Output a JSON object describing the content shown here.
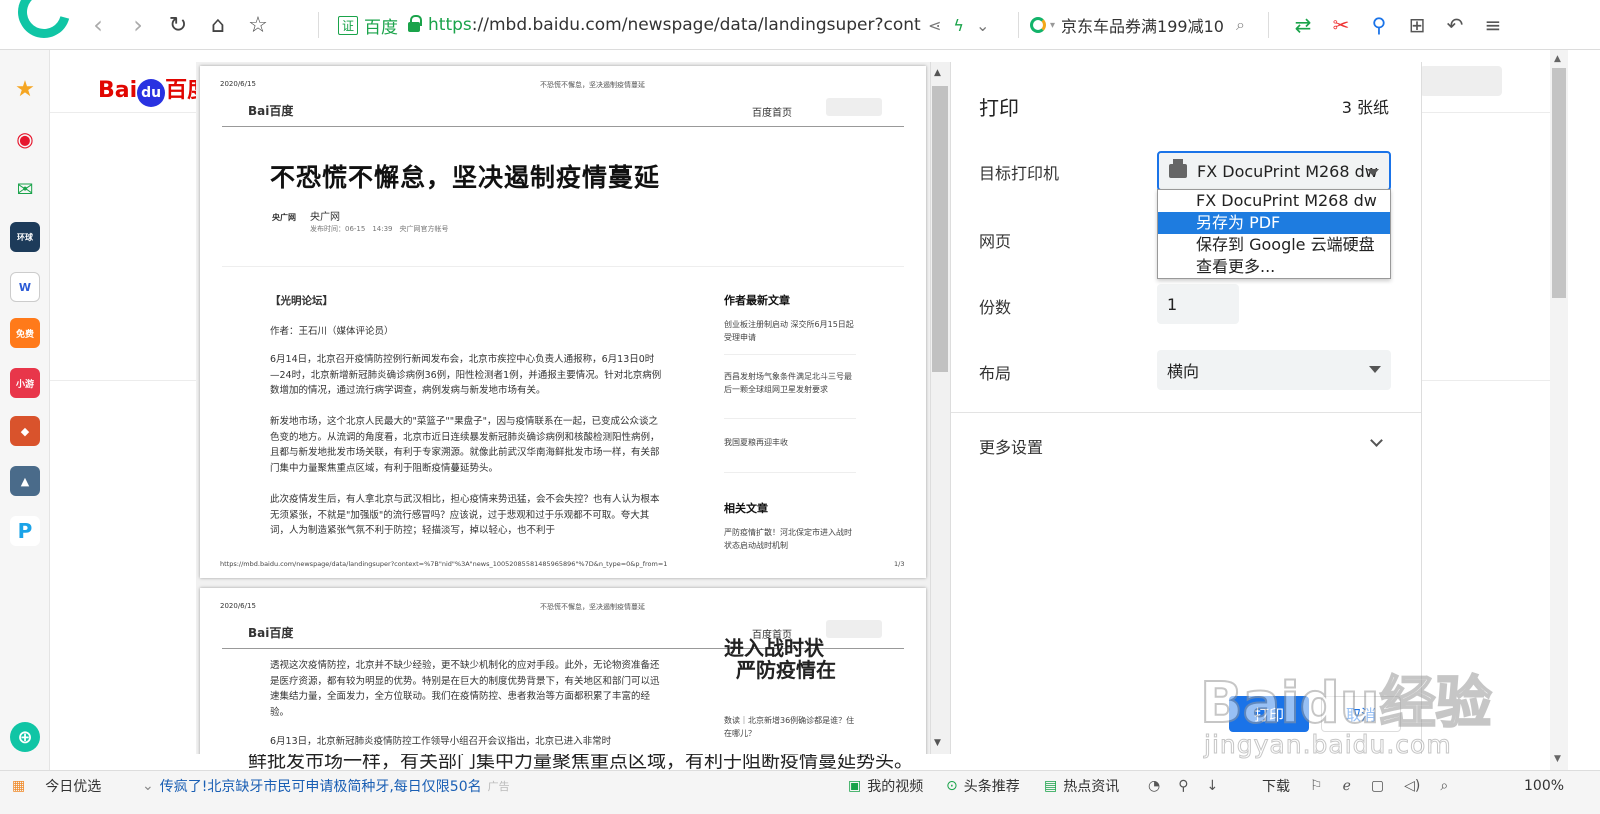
{
  "browser": {
    "addr_cert": "证",
    "addr_site": "百度",
    "url_scheme": "https",
    "url_rest": "://mbd.baidu.com/newspage/data/landingsuper?cont",
    "search_text": "京东车品券满199减10"
  },
  "background_page": {
    "logo_text": "Bai",
    "logo_du": "du",
    "logo_cn": "百度",
    "headline_fragment": "鲜批发市场一样，有关部门集中力量聚焦重点区域，有利于阻断疫情蔓延势头。"
  },
  "preview": {
    "page1": {
      "date": "2020/6/15",
      "header_title": "不恐慌不懈怠，坚决遏制疫情蔓延",
      "logo": "Bai百度",
      "home": "百度首页",
      "title": "不恐慌不懈怠，坚决遏制疫情蔓延",
      "source_logo": "央广网",
      "source": "央广网",
      "meta": "发布时间：06-15　14:39　央广网官方帐号",
      "section": "【光明论坛】",
      "author": "作者：王石川（媒体评论员）",
      "p1": "6月14日，北京召开疫情防控例行新闻发布会，北京市疾控中心负责人通报称，6月13日0时—24时，北京新增新冠肺炎确诊病例36例，阳性检测者1例，并通报主要情况。针对北京病例数增加的情况，通过流行病学调查，病例发病与新发地市场有关。",
      "p2": "新发地市场，这个北京人民最大的\"菜篮子\"\"果盘子\"，因与疫情联系在一起，已变成公众谈之色变的地方。从流调的角度看，北京市近日连续暴发新冠肺炎确诊病例和核酸检测阳性病例，且都与新发地批发市场关联，有利于专家溯源。就像此前武汉华南海鲜批发市场一样，有关部门集中力量聚焦重点区域，有利于阻断疫情蔓延势头。",
      "p3": "此次疫情发生后，有人拿北京与武汉相比，担心疫情来势迅猛，会不会失控？也有人认为根本无须紧张，不就是\"加强版\"的流行感冒吗？应该说，过于悲观和过于乐观都不可取。夸大其词，人为制造紧张气氛不利于防控；轻描淡写，掉以轻心，也不利于",
      "side_head": "作者最新文章",
      "side1": "创业板注册制启动 深交所6月15日起受理申请",
      "side2": "西昌发射场气象条件满足北斗三号最后一颗全球组网卫星发射要求",
      "side3": "我国夏粮再迎丰收",
      "side_head2": "相关文章",
      "side4": "严防疫情扩散！河北保定市进入战时状态启动战时机制",
      "footer_url": "https://mbd.baidu.com/newspage/data/landingsuper?context=%7B\"nid\"%3A\"news_10052085581485965896\"%7D&n_type=0&p_from=1",
      "page_num": "1/3"
    },
    "page2": {
      "date": "2020/6/15",
      "header_title": "不恐慌不懈怠，坚决遏制疫情蔓延",
      "logo": "Bai百度",
      "home": "百度首页",
      "p1": "透视这次疫情防控，北京并不缺少经验，更不缺少机制化的应对手段。此外，无论物资准备还是医疗资源，都有较为明显的优势。特别是在巨大的制度优势背景下，有关地区和部门可以迅速集结力量，全面发力，全方位联动。我们在疫情防控、患者救治等方面都积累了丰富的经验。",
      "p2": "6月13日，北京新冠肺炎疫情防控工作领导小组召开会议指出，北京已进入非常时",
      "big_line1": "进入战时状",
      "big_line2": "严防疫情在",
      "side1": "数读｜北京新增36例确诊都是谁？住在哪儿？"
    }
  },
  "print_panel": {
    "title": "打印",
    "sheets": "3 张纸",
    "destination_label": "目标打印机",
    "destination_value": "FX DocuPrint M268 dw",
    "pages_label": "网页",
    "copies_label": "份数",
    "copies_value": "1",
    "layout_label": "布局",
    "layout_value": "横向",
    "more_settings": "更多设置",
    "print_button": "打印",
    "cancel_button": "取消",
    "dropdown_options": [
      "FX DocuPrint M268 dw",
      "另存为 PDF",
      "保存到 Google 云端硬盘",
      "查看更多..."
    ],
    "dropdown_selected_index": 1
  },
  "watermark": {
    "main": "Baidu经验",
    "sub": "jingyan.baidu.com"
  },
  "statusbar": {
    "today": "今日优选",
    "news": "传疯了!北京缺牙市民可申请极简种牙,每日仅限50名",
    "ad": "广告",
    "my_video": "我的视频",
    "headline_rec": "头条推荐",
    "hot_news": "热点资讯",
    "download": "下载",
    "zoom": "100%"
  },
  "colors": {
    "accent_blue": "#1a73e8",
    "dropdown_selection": "#1e7ce0",
    "url_green": "#1aa34a",
    "baidu_red": "#e10601"
  }
}
